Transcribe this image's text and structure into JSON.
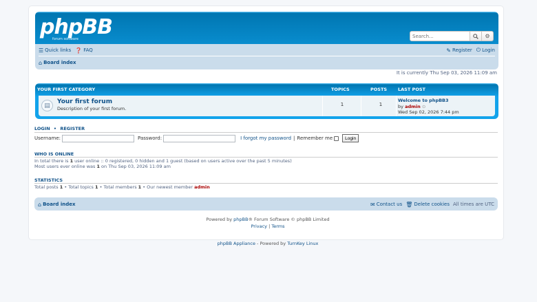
{
  "header": {
    "logo_text": "phpBB",
    "logo_tagline": "forum  software",
    "search_placeholder": "Search...",
    "search_icon": "search-icon",
    "advanced_icon": "gear-icon"
  },
  "navbar": {
    "quick_links": "Quick links",
    "faq": "FAQ",
    "register": "Register",
    "login": "Login",
    "breadcrumb": "Board index"
  },
  "current_time": "It is currently Thu Sep 03, 2026 11:09 am",
  "category": {
    "title": "YOUR FIRST CATEGORY",
    "col_topics": "TOPICS",
    "col_posts": "POSTS",
    "col_lastpost": "LAST POST",
    "forum": {
      "title": "Your first forum",
      "description": "Description of your first forum.",
      "topics": "1",
      "posts": "1",
      "last_post_title": "Welcome to phpBB3",
      "last_post_by": "by",
      "last_post_author": "admin",
      "last_post_date": "Wed Sep 02, 2026 7:44 pm"
    }
  },
  "login_section": {
    "title_login": "LOGIN",
    "separator": "•",
    "title_register": "REGISTER",
    "username_label": "Username:",
    "password_label": "Password:",
    "forgot": "I forgot my password",
    "remember_pipe": "|",
    "remember": "Remember me",
    "button": "Login"
  },
  "who_is_online": {
    "title": "WHO IS ONLINE",
    "line1_a": "In total there is ",
    "line1_num": "1",
    "line1_b": " user online :: 0 registered, 0 hidden and 1 guest (based on users active over the past 5 minutes)",
    "line2_a": "Most users ever online was ",
    "line2_num": "1",
    "line2_b": " on Thu Sep 03, 2026 11:09 am"
  },
  "statistics": {
    "title": "STATISTICS",
    "posts_label": "Total posts ",
    "posts": "1",
    "topics_label": " • Total topics ",
    "topics": "1",
    "members_label": " • Total members ",
    "members": "1",
    "newest_label": " • Our newest member ",
    "newest": "admin"
  },
  "footer_nav": {
    "breadcrumb": "Board index",
    "contact": "Contact us",
    "delete_cookies": "Delete cookies",
    "timezone": "All times are UTC"
  },
  "copyright": {
    "powered_a": "Powered by ",
    "phpbb": "phpBB",
    "powered_b": "® Forum Software © phpBB Limited",
    "privacy": "Privacy",
    "pipe": "|",
    "terms": "Terms"
  },
  "appliance": {
    "link1": "phpBB Appliance",
    "mid": " - Powered by ",
    "link2": "TurnKey Linux"
  }
}
